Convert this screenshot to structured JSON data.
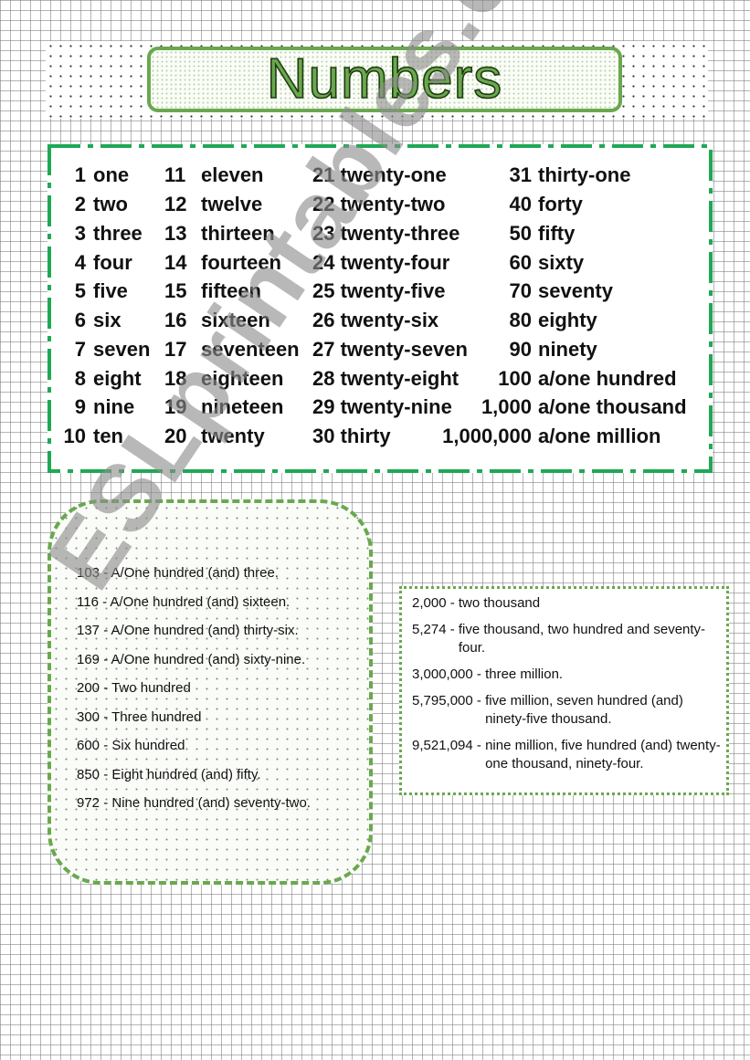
{
  "title": "Numbers",
  "colors": {
    "title_green": "#6aa84f",
    "table_border_green": "#1fa855",
    "watermark_gray": "#8c8c8c"
  },
  "table": {
    "rows": [
      [
        {
          "n": "1",
          "w": "one"
        },
        {
          "n": "11",
          "w": "eleven"
        },
        {
          "t": "21 twenty-one"
        },
        {
          "n": "31",
          "w": "thirty-one"
        }
      ],
      [
        {
          "n": "2",
          "w": "two"
        },
        {
          "n": "12",
          "w": "twelve"
        },
        {
          "t": "22 twenty-two"
        },
        {
          "n": "40",
          "w": "forty"
        }
      ],
      [
        {
          "n": "3",
          "w": "three"
        },
        {
          "n": "13",
          "w": "thirteen"
        },
        {
          "t": "23 twenty-three"
        },
        {
          "n": "50",
          "w": "fifty"
        }
      ],
      [
        {
          "n": "4",
          "w": "four"
        },
        {
          "n": "14",
          "w": "fourteen"
        },
        {
          "t": "24 twenty-four"
        },
        {
          "n": "60",
          "w": "sixty"
        }
      ],
      [
        {
          "n": "5",
          "w": "five"
        },
        {
          "n": "15",
          "w": "fifteen"
        },
        {
          "t": "25 twenty-five"
        },
        {
          "n": "70",
          "w": "seventy"
        }
      ],
      [
        {
          "n": "6",
          "w": "six"
        },
        {
          "n": "16",
          "w": "sixteen"
        },
        {
          "t": "26 twenty-six"
        },
        {
          "n": "80",
          "w": "eighty"
        }
      ],
      [
        {
          "n": "7",
          "w": "seven"
        },
        {
          "n": "17",
          "w": "seventeen"
        },
        {
          "t": "27 twenty-seven"
        },
        {
          "n": "90",
          "w": "ninety"
        }
      ],
      [
        {
          "n": "8",
          "w": "eight"
        },
        {
          "n": "18",
          "w": "eighteen"
        },
        {
          "t": "28 twenty-eight"
        },
        {
          "n": "100",
          "w": "a/one hundred"
        }
      ],
      [
        {
          "n": "9",
          "w": "nine"
        },
        {
          "n": "19",
          "w": "nineteen"
        },
        {
          "t": "29 twenty-nine"
        },
        {
          "n": "1,000",
          "w": "a/one thousand"
        }
      ],
      [
        {
          "n": "10",
          "w": "ten"
        },
        {
          "n": "20",
          "w": "twenty"
        },
        {
          "t": "30 thirty"
        },
        {
          "n": "1,000,000",
          "w": "a/one million"
        }
      ]
    ]
  },
  "hundreds": [
    "103 - A/One hundred (and) three.",
    "116 - A/One hundred (and) sixteen.",
    "137 - A/One hundred (and) thirty-six.",
    "169 - A/One hundred (and) sixty-nine.",
    "200 - Two hundred",
    "300 - Three hundred",
    "600 - Six hundred",
    "850 - Eight hundred (and) fifty.",
    "972 - Nine hundred (and) seventy-two."
  ],
  "large_numbers": [
    {
      "num": "2,000 - ",
      "text": "two thousand"
    },
    {
      "num": "5,274 - ",
      "text": "five thousand, two hundred and seventy-four."
    },
    {
      "num": "3,000,000 - ",
      "text": "three million."
    },
    {
      "num": "5,795,000 - ",
      "text": "five million, seven hundred (and) ninety-five thousand."
    },
    {
      "num": "9,521,094 - ",
      "text": "nine million, five hundred (and) twenty-one thousand, ninety-four."
    }
  ],
  "watermark": "ESLprintables.com"
}
